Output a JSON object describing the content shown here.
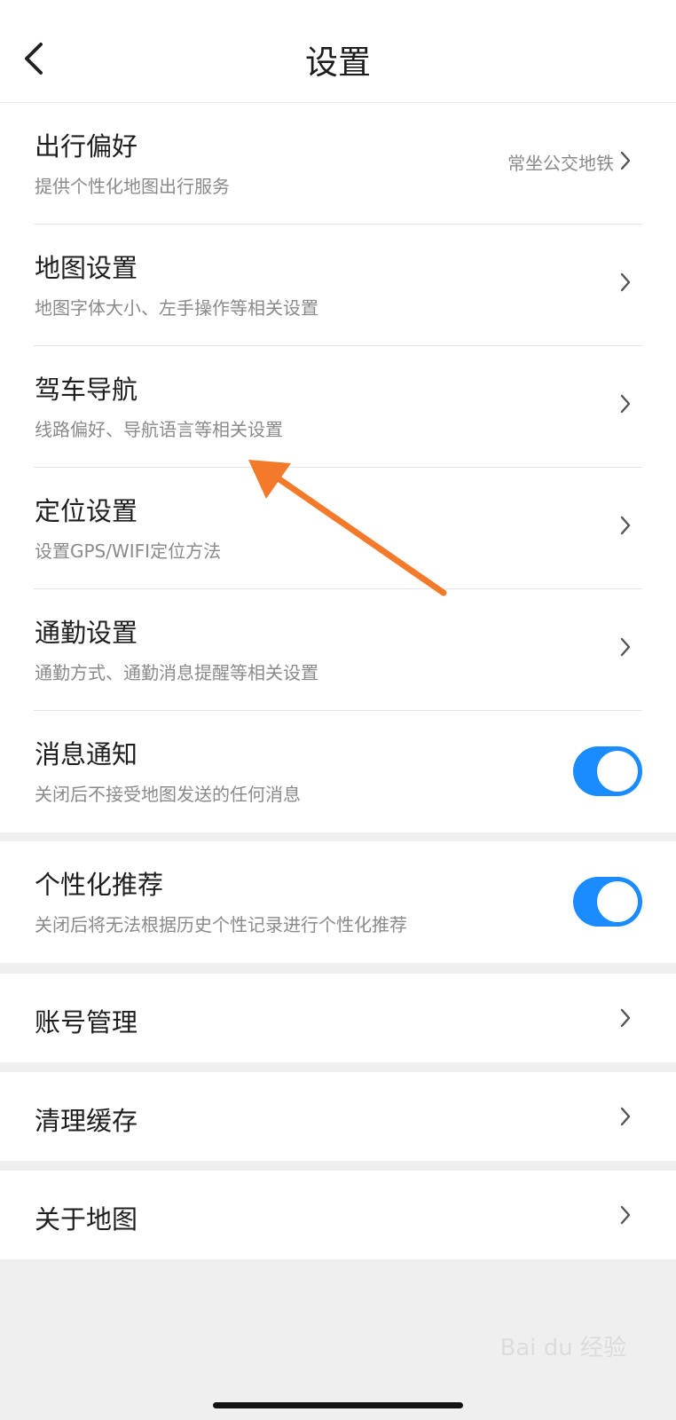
{
  "header": {
    "title": "设置"
  },
  "group_main": {
    "rows": [
      {
        "title": "出行偏好",
        "subtitle": "提供个性化地图出行服务",
        "value": "常坐公交地铁"
      },
      {
        "title": "地图设置",
        "subtitle": "地图字体大小、左手操作等相关设置"
      },
      {
        "title": "驾车导航",
        "subtitle": "线路偏好、导航语言等相关设置"
      },
      {
        "title": "定位设置",
        "subtitle": "设置GPS/WIFI定位方法"
      },
      {
        "title": "通勤设置",
        "subtitle": "通勤方式、通勤消息提醒等相关设置"
      },
      {
        "title": "消息通知",
        "subtitle": "关闭后不接受地图发送的任何消息",
        "toggle_on": true
      }
    ]
  },
  "group_personal": {
    "title": "个性化推荐",
    "subtitle": "关闭后将无法根据历史个性记录进行个性化推荐",
    "toggle_on": true
  },
  "account": {
    "title": "账号管理"
  },
  "cache": {
    "title": "清理缓存"
  },
  "about": {
    "title": "关于地图"
  },
  "watermark": "Bai du 经验",
  "colors": {
    "accent": "#1a8cff",
    "annotation_arrow": "#f47a2b"
  },
  "icons": {
    "back": "chevron-left-icon",
    "row_arrow": "chevron-right-icon",
    "annotation": "arrow-annotation"
  }
}
